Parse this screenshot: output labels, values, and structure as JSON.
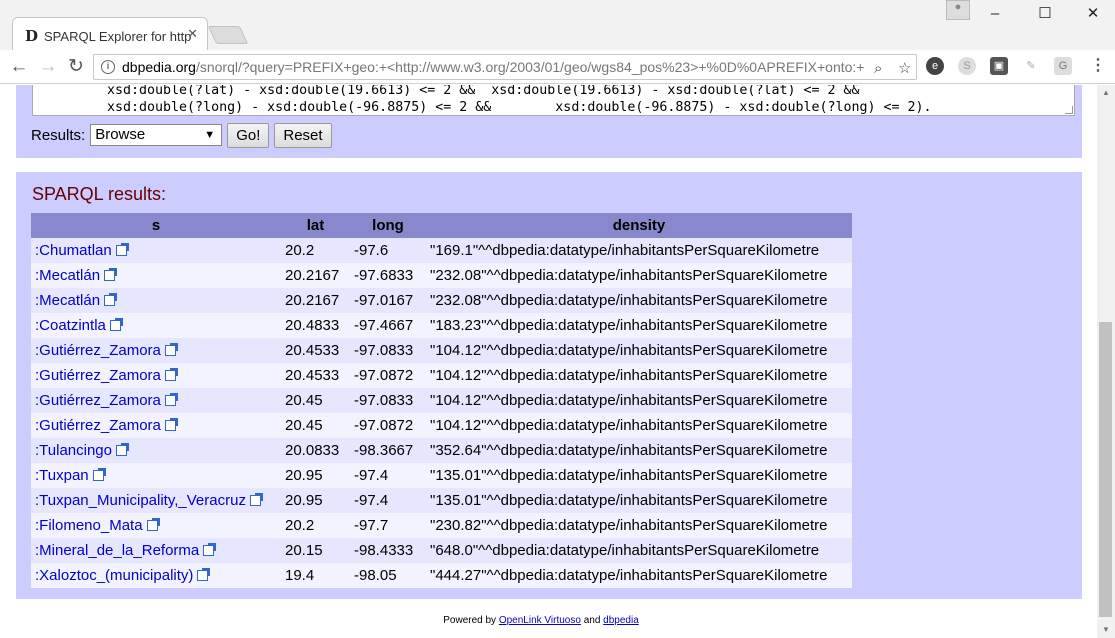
{
  "browser": {
    "tab_title": "SPARQL Explorer for http",
    "tab_favicon": "D",
    "url_host": "dbpedia.org",
    "url_path": "/snorql/?query=PREFIX+geo:+<http://www.w3.org/2003/01/geo/wgs84_pos%23>+%0D%0APREFIX+onto:+"
  },
  "query": {
    "line1": "xsd:double(?lat) - xsd:double(19.6613) <= 2 &&  xsd:double(19.6613) - xsd:double(?lat) <= 2 &&",
    "line2": "xsd:double(?long) - xsd:double(-96.8875) <= 2 &&        xsd:double(-96.8875) - xsd:double(?long) <= 2)."
  },
  "controls": {
    "results_label": "Results:",
    "results_select": "Browse",
    "go_label": "Go!",
    "reset_label": "Reset"
  },
  "results": {
    "title": "SPARQL results:",
    "columns": [
      "s",
      "lat",
      "long",
      "density"
    ],
    "rows": [
      {
        "s": ":Chumatlan",
        "lat": "20.2",
        "long": "-97.6",
        "density": "\"169.1\"^^dbpedia:datatype/inhabitantsPerSquareKilometre"
      },
      {
        "s": ":Mecatlán",
        "lat": "20.2167",
        "long": "-97.6833",
        "density": "\"232.08\"^^dbpedia:datatype/inhabitantsPerSquareKilometre"
      },
      {
        "s": ":Mecatlán",
        "lat": "20.2167",
        "long": "-97.0167",
        "density": "\"232.08\"^^dbpedia:datatype/inhabitantsPerSquareKilometre"
      },
      {
        "s": ":Coatzintla",
        "lat": "20.4833",
        "long": "-97.4667",
        "density": "\"183.23\"^^dbpedia:datatype/inhabitantsPerSquareKilometre"
      },
      {
        "s": ":Gutiérrez_Zamora",
        "lat": "20.4533",
        "long": "-97.0833",
        "density": "\"104.12\"^^dbpedia:datatype/inhabitantsPerSquareKilometre"
      },
      {
        "s": ":Gutiérrez_Zamora",
        "lat": "20.4533",
        "long": "-97.0872",
        "density": "\"104.12\"^^dbpedia:datatype/inhabitantsPerSquareKilometre"
      },
      {
        "s": ":Gutiérrez_Zamora",
        "lat": "20.45",
        "long": "-97.0833",
        "density": "\"104.12\"^^dbpedia:datatype/inhabitantsPerSquareKilometre"
      },
      {
        "s": ":Gutiérrez_Zamora",
        "lat": "20.45",
        "long": "-97.0872",
        "density": "\"104.12\"^^dbpedia:datatype/inhabitantsPerSquareKilometre"
      },
      {
        "s": ":Tulancingo",
        "lat": "20.0833",
        "long": "-98.3667",
        "density": "\"352.64\"^^dbpedia:datatype/inhabitantsPerSquareKilometre"
      },
      {
        "s": ":Tuxpan",
        "lat": "20.95",
        "long": "-97.4",
        "density": "\"135.01\"^^dbpedia:datatype/inhabitantsPerSquareKilometre"
      },
      {
        "s": ":Tuxpan_Municipality,_Veracruz",
        "lat": "20.95",
        "long": "-97.4",
        "density": "\"135.01\"^^dbpedia:datatype/inhabitantsPerSquareKilometre"
      },
      {
        "s": ":Filomeno_Mata",
        "lat": "20.2",
        "long": "-97.7",
        "density": "\"230.82\"^^dbpedia:datatype/inhabitantsPerSquareKilometre"
      },
      {
        "s": ":Mineral_de_la_Reforma",
        "lat": "20.15",
        "long": "-98.4333",
        "density": "\"648.0\"^^dbpedia:datatype/inhabitantsPerSquareKilometre"
      },
      {
        "s": ":Xaloztoc_(municipality)",
        "lat": "19.4",
        "long": "-98.05",
        "density": "\"444.27\"^^dbpedia:datatype/inhabitantsPerSquareKilometre"
      }
    ]
  },
  "footer": {
    "prefix": "Powered by ",
    "link1": "OpenLink Virtuoso",
    "middle": " and ",
    "link2": "dbpedia"
  }
}
